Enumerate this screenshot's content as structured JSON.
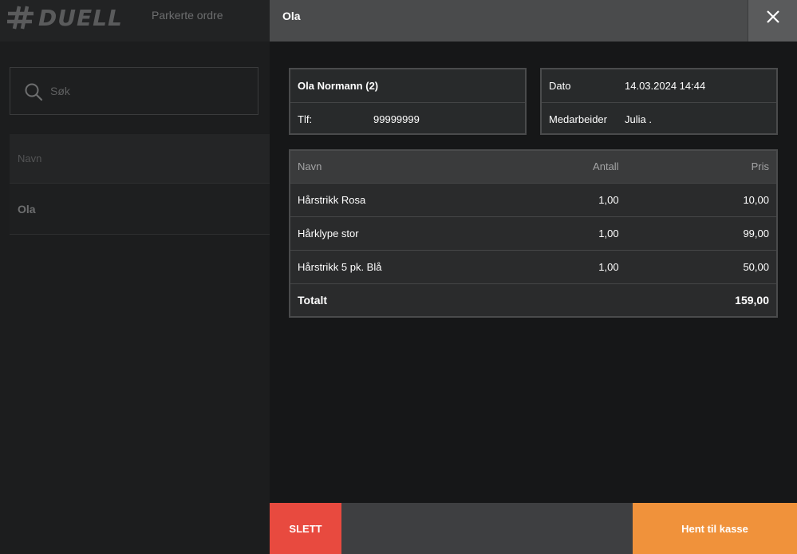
{
  "app": {
    "logo_text": "DUELL",
    "page_title": "Parkerte ordre"
  },
  "search": {
    "icon": "search-icon",
    "placeholder": "Søk",
    "value": ""
  },
  "order_list": {
    "header_label": "Navn",
    "items": [
      {
        "label": "Ola"
      }
    ]
  },
  "modal": {
    "title": "Ola",
    "close_icon": "close-icon",
    "customer": {
      "name": "Ola Normann (2)",
      "phone_label": "Tlf:",
      "phone_value": "99999999"
    },
    "meta": {
      "date_label": "Dato",
      "date_value": "14.03.2024 14:44",
      "employee_label": "Medarbeider",
      "employee_value": "Julia ."
    },
    "table": {
      "headers": {
        "name": "Navn",
        "qty": "Antall",
        "price": "Pris"
      },
      "rows": [
        {
          "name": "Hårstrikk Rosa",
          "qty": "1,00",
          "price": "10,00"
        },
        {
          "name": "Hårklype stor",
          "qty": "1,00",
          "price": "99,00"
        },
        {
          "name": "Hårstrikk 5 pk. Blå",
          "qty": "1,00",
          "price": "50,00"
        }
      ],
      "total_label": "Totalt",
      "total_value": "159,00"
    },
    "footer": {
      "delete_label": "SLETT",
      "fetch_label": "Hent til kasse"
    }
  },
  "colors": {
    "delete": "#e84a3f",
    "fetch": "#f0923b",
    "modal_header": "#4a4b4c"
  }
}
